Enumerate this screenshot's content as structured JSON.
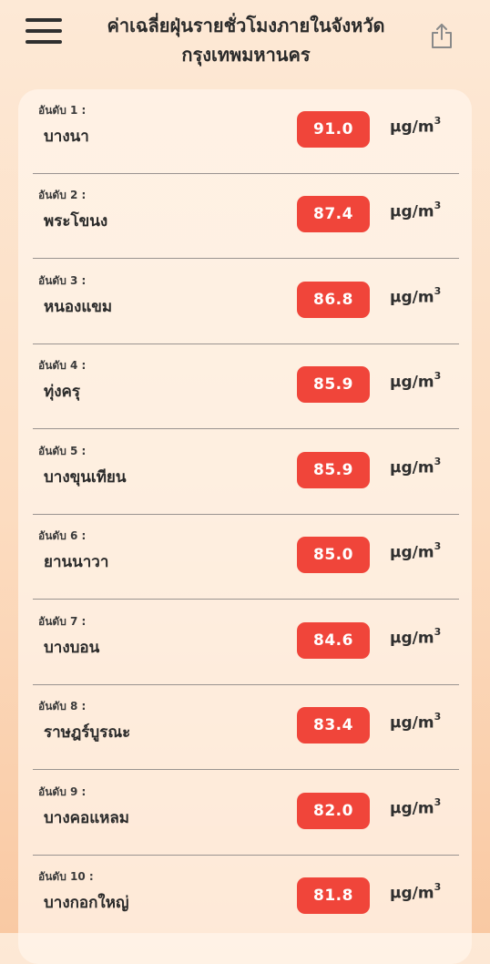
{
  "header": {
    "title": "ค่าเฉลี่ยฝุ่นรายชั่วโมงภายในจังหวัด กรุงเทพมหานคร"
  },
  "colors": {
    "value_badge": "#f0453a",
    "background_top": "#fde9d6",
    "background_bottom": "#f9c9a3"
  },
  "icons": {
    "menu": "hamburger-icon",
    "share": "share-icon"
  },
  "unit": {
    "base": "µg/m",
    "exponent": "3"
  },
  "rankings": [
    {
      "rank": "อันดับ 1 :",
      "district": "บางนา",
      "value": "91.0"
    },
    {
      "rank": "อันดับ 2 :",
      "district": "พระโขนง",
      "value": "87.4"
    },
    {
      "rank": "อันดับ 3 :",
      "district": "หนองแขม",
      "value": "86.8"
    },
    {
      "rank": "อันดับ 4 :",
      "district": "ทุ่งครุ",
      "value": "85.9"
    },
    {
      "rank": "อันดับ 5 :",
      "district": "บางขุนเทียน",
      "value": "85.9"
    },
    {
      "rank": "อันดับ 6 :",
      "district": "ยานนาวา",
      "value": "85.0"
    },
    {
      "rank": "อันดับ 7 :",
      "district": "บางบอน",
      "value": "84.6"
    },
    {
      "rank": "อันดับ 8 :",
      "district": "ราษฎร์บูรณะ",
      "value": "83.4"
    },
    {
      "rank": "อันดับ 9 :",
      "district": "บางคอแหลม",
      "value": "82.0"
    },
    {
      "rank": "อันดับ 10 :",
      "district": "บางกอกใหญ่",
      "value": "81.8"
    }
  ]
}
